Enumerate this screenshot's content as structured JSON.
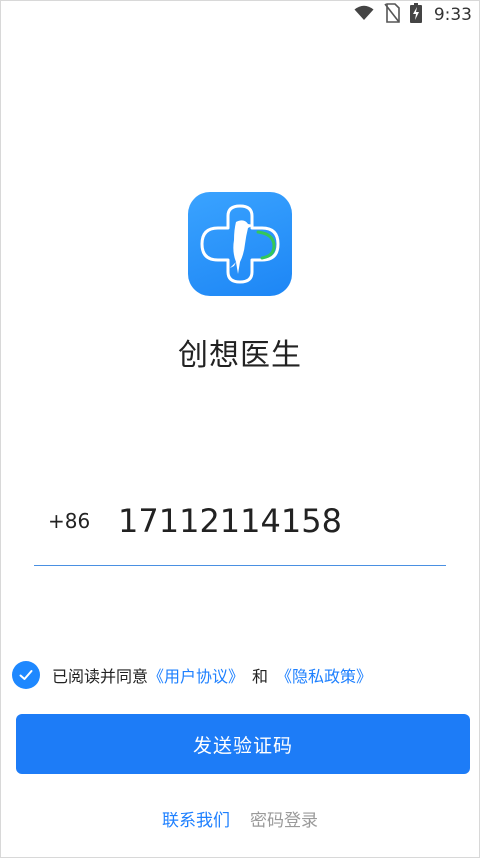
{
  "status_bar": {
    "time": "9:33",
    "icons": [
      "wifi-icon",
      "no-sim-icon",
      "battery-charging-icon"
    ]
  },
  "app": {
    "name": "创想医生",
    "icon": "woodpecker-cloud-logo",
    "brand_color": "#1d86f5"
  },
  "login": {
    "country_code": "+86",
    "phone_value": "17112114158",
    "agreement": {
      "checked": true,
      "prefix": "已阅读并同意",
      "user_agreement": "《用户协议》",
      "conjunction": "和",
      "privacy_policy": "《隐私政策》"
    },
    "send_code_label": "发送验证码",
    "contact_us_label": "联系我们",
    "password_login_label": "密码登录"
  },
  "colors": {
    "primary": "#1d7cf7",
    "link": "#1e80ff",
    "muted": "#9a9a9a"
  }
}
